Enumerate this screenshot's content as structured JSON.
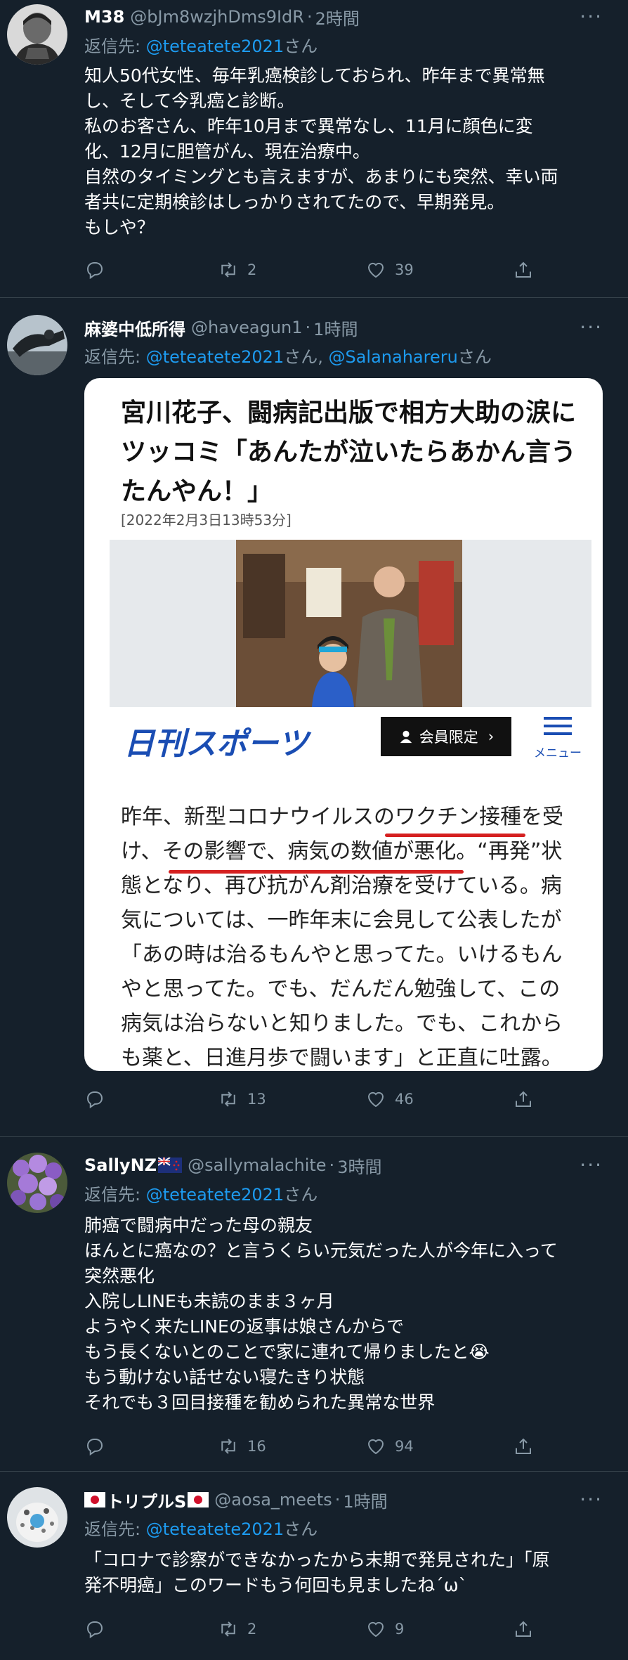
{
  "tweets": [
    {
      "display_name": "M38",
      "handle": "@bJm8wzjhDms9IdR",
      "time": "2時間",
      "reply_prefix": "返信先: ",
      "mentions": [
        "@teteatete2021"
      ],
      "suffix": "さん",
      "body": [
        "知人50代女性、毎年乳癌検診しておられ、昨年まで異常無",
        "し、そして今乳癌と診断。",
        "私のお客さん、昨年10月まで異常なし、11月に顔色に変",
        "化、12月に胆管がん、現在治療中。",
        "自然のタイミングとも言えますが、あまりにも突然、幸い両",
        "者共に定期検診はしっかりされてたので、早期発見。",
        "もしや？"
      ],
      "replies": "",
      "retweets": "2",
      "likes": "39"
    },
    {
      "display_name": "麻婆中低所得",
      "handle": "@haveagun1",
      "time": "1時間",
      "reply_prefix": "返信先: ",
      "mentions": [
        "@teteatete2021",
        "@Salanahareru"
      ],
      "suffix": "さん",
      "separator": ", ",
      "media": {
        "title_lines": [
          "宮川花子、闘病記出版で相方大助の涙に",
          "ツッコミ「あんたが泣いたらあかん言う",
          "たんやん！」"
        ],
        "date": "[2022年2月3日13時53分]",
        "brand": "日刊スポーツ",
        "member_button": "会員限定",
        "menu_label": "メニュー",
        "article_lines": [
          "昨年、新型コロナウイルスのワクチン接種を受",
          "け、その影響で、病気の数値が悪化。“再発”状",
          "態となり、再び抗がん剤治療を受けている。病",
          "気については、一昨年末に会見して公表したが",
          "「あの時は治るもんやと思ってた。いけるもん",
          "やと思ってた。でも、だんだん勉強して、この",
          "病気は治らないと知りました。でも、これから",
          "も薬と、日進月歩で闘います」と正直に吐露。"
        ]
      },
      "replies": "",
      "retweets": "13",
      "likes": "46"
    },
    {
      "display_name": "SallyNZ",
      "handle": "@sallymalachite",
      "time": "3時間",
      "reply_prefix": "返信先: ",
      "mentions": [
        "@teteatete2021"
      ],
      "suffix": "さん",
      "body": [
        "肺癌で闘病中だった母の親友",
        "ほんとに癌なの？と言うくらい元気だった人が今年に入って",
        "突然悪化",
        "入院しLINEも未読のまま３ヶ月",
        "ようやく来たLINEの返事は娘さんからで",
        "もう長くないとのことで家に連れて帰りましたと😭",
        "もう動けない話せない寝たきり状態",
        "それでも３回目接種を勧められた異常な世界"
      ],
      "replies": "",
      "retweets": "16",
      "likes": "94"
    },
    {
      "display_name": "トリプルS",
      "handle": "@aosa_meets",
      "time": "1時間",
      "reply_prefix": "返信先: ",
      "mentions": [
        "@teteatete2021"
      ],
      "suffix": "さん",
      "body": [
        "「コロナで診察ができなかったから末期で発見された」「原",
        "発不明癌」このワードもう何回も見ましたね´ω`"
      ],
      "replies": "",
      "retweets": "2",
      "likes": "9"
    }
  ],
  "colors": {
    "background": "#15202b",
    "text": "#ffffff",
    "muted": "#8899a6",
    "link": "#1d9bf0",
    "divider": "#38444d",
    "underline_red": "#d52020",
    "brand_blue": "#1a4db3"
  },
  "icons": [
    "reply-icon",
    "retweet-icon",
    "like-icon",
    "share-icon",
    "more-icon",
    "flag-nz-icon",
    "flag-japan-icon",
    "person-icon",
    "hamburger-menu-icon"
  ]
}
